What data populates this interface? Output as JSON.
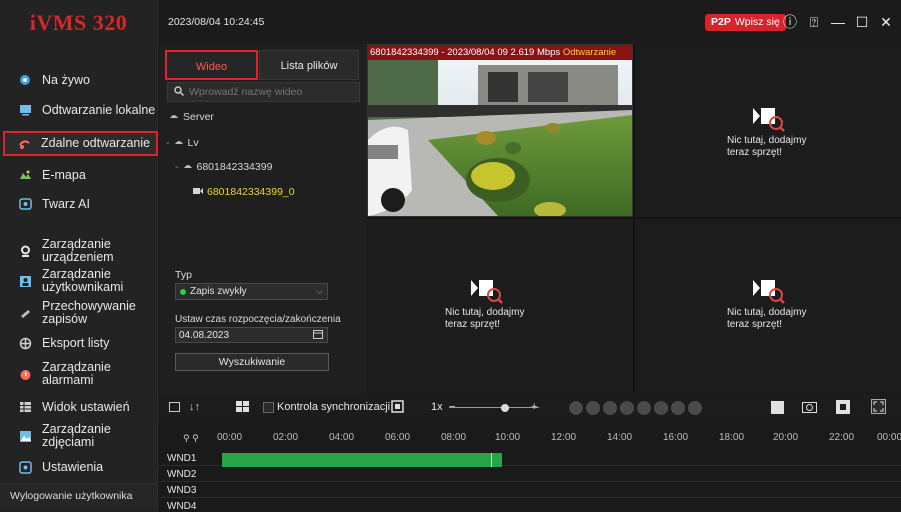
{
  "app": {
    "logo": "iVMS 320",
    "datetime": "2023/08/04 10:24:45"
  },
  "topbar": {
    "p2p_tag": "P2P",
    "p2p_label": "Wpisz się"
  },
  "sidebar": {
    "items": [
      {
        "label": "Na żywo",
        "icon": "live-icon"
      },
      {
        "label": "Odtwarzanie lokalne",
        "icon": "local-playback-icon"
      },
      {
        "label": "Zdalne odtwarzanie",
        "icon": "remote-playback-icon",
        "active": true
      },
      {
        "label": "E-mapa",
        "icon": "emap-icon"
      },
      {
        "label": "Twarz AI",
        "icon": "face-ai-icon"
      },
      {
        "label": "Zarządzanie urządzeniem",
        "icon": "device-icon"
      },
      {
        "label": "Zarządzanie użytkownikami",
        "icon": "users-icon"
      },
      {
        "label": "Przechowywanie zapisów",
        "icon": "storage-icon"
      },
      {
        "label": "Eksport listy",
        "icon": "export-icon"
      },
      {
        "label": "Zarządzanie alarmami",
        "icon": "alarm-icon"
      },
      {
        "label": "Widok ustawień",
        "icon": "view-settings-icon"
      },
      {
        "label": "Zarządzanie zdjęciami",
        "icon": "pictures-icon"
      },
      {
        "label": "Ustawienia",
        "icon": "settings-icon"
      }
    ],
    "logout": "Wylogowanie użytkownika"
  },
  "panel": {
    "tab_video": "Wideo",
    "tab_files": "Lista plików",
    "search_placeholder": "Wprowadź nazwę wideo",
    "tree": [
      "Server",
      "Lv",
      "6801842334399",
      "6801842334399_0"
    ],
    "type_label": "Typ",
    "type_value": "Zapis zwykły",
    "time_label": "Ustaw czas rozpoczęcia/zakończenia",
    "date_value": "04.08.2023",
    "search_button": "Wyszukiwanie"
  },
  "video": {
    "cam_title": "6801842334399 - 2023/08/04 09",
    "cam_rate": "2.619 Mbps",
    "cam_status": "Odtwarzanie",
    "empty_line1": "Nic tutaj, dodajmy",
    "empty_line2": "teraz sprzęt!"
  },
  "controls": {
    "sync_label": "Kontrola synchronizacji",
    "speed": "1x"
  },
  "timeline": {
    "hours": [
      "00:00",
      "02:00",
      "04:00",
      "06:00",
      "08:00",
      "10:00",
      "12:00",
      "14:00",
      "16:00",
      "18:00",
      "20:00",
      "22:00",
      "00:00"
    ],
    "windows": [
      "WND1",
      "WND2",
      "WND3",
      "WND4"
    ],
    "recording_hours": [
      0,
      10.0
    ],
    "cursor_hour": 9.6
  }
}
